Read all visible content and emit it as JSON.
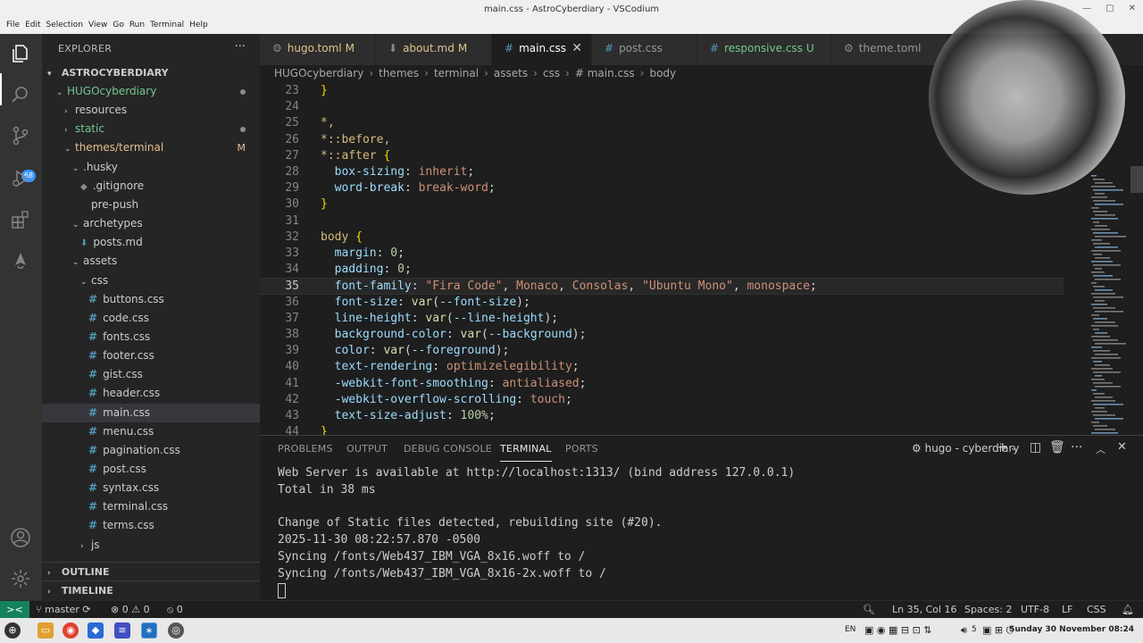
{
  "window": {
    "title": "main.css - AstroCyberdiary - VSCodium",
    "menu": [
      "File",
      "Edit",
      "Selection",
      "View",
      "Go",
      "Run",
      "Terminal",
      "Help"
    ]
  },
  "activitybar": {
    "scm_badge": "68"
  },
  "sidebar": {
    "header": "EXPLORER",
    "more": "···",
    "workspace": "ASTROCYBERDIARY",
    "tree": [
      {
        "label": "HUGOcyberdiary",
        "indent": 0,
        "kind": "folder-open",
        "color": "green",
        "dot": "grey"
      },
      {
        "label": "resources",
        "indent": 1,
        "kind": "folder-closed"
      },
      {
        "label": "static",
        "indent": 1,
        "kind": "folder-closed",
        "color": "green",
        "dot": "grey"
      },
      {
        "label": "themes/terminal",
        "indent": 1,
        "kind": "folder-open",
        "color": "yellow",
        "mod": "M"
      },
      {
        "label": ".husky",
        "indent": 2,
        "kind": "folder-open"
      },
      {
        "label": ".gitignore",
        "indent": 3,
        "kind": "gitignore"
      },
      {
        "label": "pre-push",
        "indent": 3,
        "kind": "file"
      },
      {
        "label": "archetypes",
        "indent": 2,
        "kind": "folder-open"
      },
      {
        "label": "posts.md",
        "indent": 3,
        "kind": "md"
      },
      {
        "label": "assets",
        "indent": 2,
        "kind": "folder-open"
      },
      {
        "label": "css",
        "indent": 3,
        "kind": "folder-open"
      },
      {
        "label": "buttons.css",
        "indent": 4,
        "kind": "css"
      },
      {
        "label": "code.css",
        "indent": 4,
        "kind": "css"
      },
      {
        "label": "fonts.css",
        "indent": 4,
        "kind": "css"
      },
      {
        "label": "footer.css",
        "indent": 4,
        "kind": "css"
      },
      {
        "label": "gist.css",
        "indent": 4,
        "kind": "css"
      },
      {
        "label": "header.css",
        "indent": 4,
        "kind": "css"
      },
      {
        "label": "main.css",
        "indent": 4,
        "kind": "css",
        "selected": true
      },
      {
        "label": "menu.css",
        "indent": 4,
        "kind": "css"
      },
      {
        "label": "pagination.css",
        "indent": 4,
        "kind": "css"
      },
      {
        "label": "post.css",
        "indent": 4,
        "kind": "css"
      },
      {
        "label": "syntax.css",
        "indent": 4,
        "kind": "css"
      },
      {
        "label": "terminal.css",
        "indent": 4,
        "kind": "css"
      },
      {
        "label": "terms.css",
        "indent": 4,
        "kind": "css"
      },
      {
        "label": "js",
        "indent": 3,
        "kind": "folder-closed"
      }
    ],
    "outline": "OUTLINE",
    "timeline": "TIMELINE"
  },
  "tabs": [
    {
      "label": "hugo.toml",
      "mod": "M",
      "icon": "gear-icon",
      "color": "yellow"
    },
    {
      "label": "about.md",
      "mod": "M",
      "icon": "markdown-icon",
      "color": "yellow"
    },
    {
      "label": "main.css",
      "mod": "",
      "icon": "css-icon",
      "active": true
    },
    {
      "label": "post.css",
      "mod": "",
      "icon": "css-icon"
    },
    {
      "label": "responsive.css",
      "mod": "U",
      "icon": "css-icon",
      "color": "green"
    },
    {
      "label": "theme.toml",
      "mod": "",
      "icon": "gear-icon"
    }
  ],
  "breadcrumb": [
    "HUGOcyberdiary",
    "themes",
    "terminal",
    "assets",
    "css",
    "# main.css",
    "body"
  ],
  "editor": {
    "current_line": 35,
    "lines": [
      {
        "n": 23,
        "tokens": [
          [
            "brace",
            "}"
          ]
        ]
      },
      {
        "n": 24,
        "tokens": []
      },
      {
        "n": 25,
        "tokens": [
          [
            "sel",
            "*,"
          ]
        ]
      },
      {
        "n": 26,
        "tokens": [
          [
            "sel",
            "*::before,"
          ]
        ]
      },
      {
        "n": 27,
        "tokens": [
          [
            "sel",
            "*::after "
          ],
          [
            "brace",
            "{"
          ]
        ]
      },
      {
        "n": 28,
        "tokens": [
          [
            "plain",
            "  "
          ],
          [
            "prop",
            "box-sizing"
          ],
          [
            "plain",
            ": "
          ],
          [
            "val",
            "inherit"
          ],
          [
            "plain",
            ";"
          ]
        ]
      },
      {
        "n": 29,
        "tokens": [
          [
            "plain",
            "  "
          ],
          [
            "prop",
            "word-break"
          ],
          [
            "plain",
            ": "
          ],
          [
            "val",
            "break-word"
          ],
          [
            "plain",
            ";"
          ]
        ]
      },
      {
        "n": 30,
        "tokens": [
          [
            "brace",
            "}"
          ]
        ]
      },
      {
        "n": 31,
        "tokens": []
      },
      {
        "n": 32,
        "tokens": [
          [
            "sel",
            "body "
          ],
          [
            "brace",
            "{"
          ]
        ]
      },
      {
        "n": 33,
        "tokens": [
          [
            "plain",
            "  "
          ],
          [
            "prop",
            "margin"
          ],
          [
            "plain",
            ": "
          ],
          [
            "num",
            "0"
          ],
          [
            "plain",
            ";"
          ]
        ]
      },
      {
        "n": 34,
        "tokens": [
          [
            "plain",
            "  "
          ],
          [
            "prop",
            "padding"
          ],
          [
            "plain",
            ": "
          ],
          [
            "num",
            "0"
          ],
          [
            "plain",
            ";"
          ]
        ]
      },
      {
        "n": 35,
        "tokens": [
          [
            "plain",
            "  "
          ],
          [
            "prop",
            "font-family"
          ],
          [
            "plain",
            ": "
          ],
          [
            "val",
            "\"Fira Code\""
          ],
          [
            "plain",
            ", "
          ],
          [
            "val",
            "Monaco"
          ],
          [
            "plain",
            ", "
          ],
          [
            "val",
            "Consolas"
          ],
          [
            "plain",
            ", "
          ],
          [
            "val",
            "\"Ubuntu Mono\""
          ],
          [
            "plain",
            ", "
          ],
          [
            "val",
            "monospace"
          ],
          [
            "plain",
            ";"
          ]
        ]
      },
      {
        "n": 36,
        "tokens": [
          [
            "plain",
            "  "
          ],
          [
            "prop",
            "font-size"
          ],
          [
            "plain",
            ": "
          ],
          [
            "fn",
            "var"
          ],
          [
            "plain",
            "("
          ],
          [
            "prop",
            "--font-size"
          ],
          [
            "plain",
            ");"
          ]
        ]
      },
      {
        "n": 37,
        "tokens": [
          [
            "plain",
            "  "
          ],
          [
            "prop",
            "line-height"
          ],
          [
            "plain",
            ": "
          ],
          [
            "fn",
            "var"
          ],
          [
            "plain",
            "("
          ],
          [
            "prop",
            "--line-height"
          ],
          [
            "plain",
            ");"
          ]
        ]
      },
      {
        "n": 38,
        "tokens": [
          [
            "plain",
            "  "
          ],
          [
            "prop",
            "background-color"
          ],
          [
            "plain",
            ": "
          ],
          [
            "fn",
            "var"
          ],
          [
            "plain",
            "("
          ],
          [
            "prop",
            "--background"
          ],
          [
            "plain",
            ");"
          ]
        ]
      },
      {
        "n": 39,
        "tokens": [
          [
            "plain",
            "  "
          ],
          [
            "prop",
            "color"
          ],
          [
            "plain",
            ": "
          ],
          [
            "fn",
            "var"
          ],
          [
            "plain",
            "("
          ],
          [
            "prop",
            "--foreground"
          ],
          [
            "plain",
            ");"
          ]
        ]
      },
      {
        "n": 40,
        "tokens": [
          [
            "plain",
            "  "
          ],
          [
            "prop",
            "text-rendering"
          ],
          [
            "plain",
            ": "
          ],
          [
            "val",
            "optimizelegibility"
          ],
          [
            "plain",
            ";"
          ]
        ]
      },
      {
        "n": 41,
        "tokens": [
          [
            "plain",
            "  "
          ],
          [
            "prop",
            "-webkit-font-smoothing"
          ],
          [
            "plain",
            ": "
          ],
          [
            "val",
            "antialiased"
          ],
          [
            "plain",
            ";"
          ]
        ]
      },
      {
        "n": 42,
        "tokens": [
          [
            "plain",
            "  "
          ],
          [
            "prop",
            "-webkit-overflow-scrolling"
          ],
          [
            "plain",
            ": "
          ],
          [
            "val",
            "touch"
          ],
          [
            "plain",
            ";"
          ]
        ]
      },
      {
        "n": 43,
        "tokens": [
          [
            "plain",
            "  "
          ],
          [
            "prop",
            "text-size-adjust"
          ],
          [
            "plain",
            ": "
          ],
          [
            "num",
            "100%"
          ],
          [
            "plain",
            ";"
          ]
        ]
      },
      {
        "n": 44,
        "tokens": [
          [
            "brace",
            "}"
          ]
        ]
      }
    ]
  },
  "panel": {
    "tabs": [
      "PROBLEMS",
      "OUTPUT",
      "DEBUG CONSOLE",
      "TERMINAL",
      "PORTS"
    ],
    "active_tab": "TERMINAL",
    "terminal_name": "hugo - cyberdiary",
    "terminal_lines": [
      "Web Server is available at http://localhost:1313/ (bind address 127.0.0.1)",
      "Total in 38 ms",
      "",
      "Change of Static files detected, rebuilding site (#20).",
      "2025-11-30 08:22:57.870 -0500",
      "Syncing /fonts/Web437_IBM_VGA_8x16.woff to /",
      "Syncing /fonts/Web437_IBM_VGA_8x16-2x.woff to /"
    ]
  },
  "statusbar": {
    "branch": "master",
    "errors": "0",
    "warnings": "0",
    "ports": "0",
    "cursor": "Ln 35, Col 16",
    "spaces": "Spaces: 2",
    "encoding": "UTF-8",
    "eol": "LF",
    "language": "CSS"
  },
  "taskbar": {
    "lang": "EN",
    "volume": "5",
    "clock": "Sunday 30 November 08:24"
  },
  "colors": {
    "accent": "#007acc",
    "remote": "#16825d",
    "modified": "#e2c08d",
    "untracked": "#73c991"
  }
}
